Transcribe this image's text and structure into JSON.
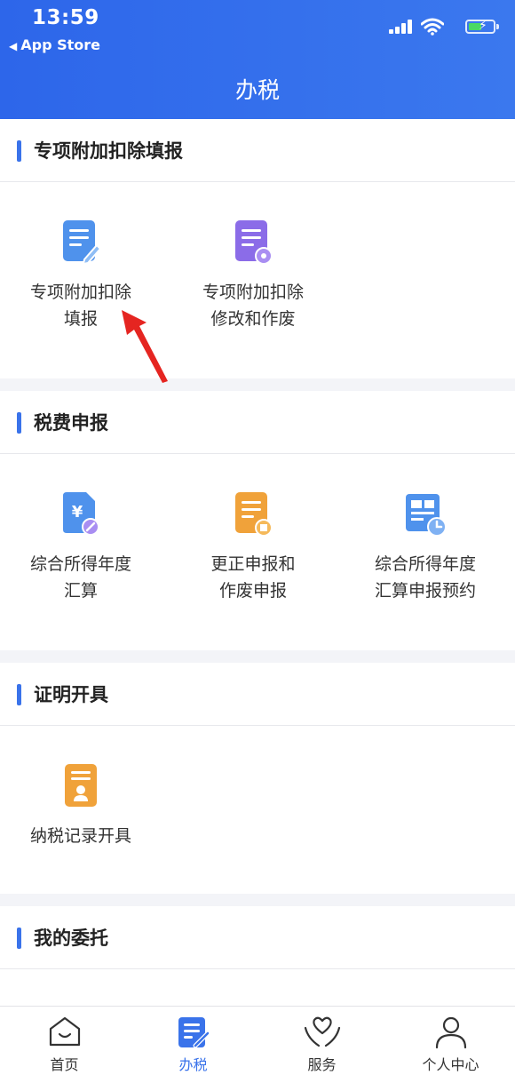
{
  "status_bar": {
    "time": "13:59",
    "back_label": "App Store"
  },
  "page": {
    "title": "办税"
  },
  "sections": [
    {
      "title": "专项附加扣除填报",
      "items": [
        {
          "label": "专项附加扣除\n填报",
          "icon": "doc-edit-icon"
        },
        {
          "label": "专项附加扣除\n修改和作废",
          "icon": "doc-gear-icon"
        }
      ]
    },
    {
      "title": "税费申报",
      "items": [
        {
          "label": "综合所得年度\n汇算",
          "icon": "yuan-doc-icon"
        },
        {
          "label": "更正申报和\n作废申报",
          "icon": "doc-stop-icon"
        },
        {
          "label": "综合所得年度\n汇算申报预约",
          "icon": "calendar-clock-icon"
        }
      ]
    },
    {
      "title": "证明开具",
      "items": [
        {
          "label": "纳税记录开具",
          "icon": "certificate-icon"
        }
      ]
    },
    {
      "title": "我的委托",
      "items": []
    }
  ],
  "tabbar": [
    {
      "label": "首页",
      "icon": "home-icon",
      "active": false
    },
    {
      "label": "办税",
      "icon": "tax-doc-icon",
      "active": true
    },
    {
      "label": "服务",
      "icon": "heart-hands-icon",
      "active": false
    },
    {
      "label": "个人中心",
      "icon": "person-icon",
      "active": false
    }
  ],
  "colors": {
    "header_blue": "#2d66ea",
    "accent_blue": "#3a73ea",
    "icon_blue": "#4f92ec",
    "icon_purple": "#8b6ce8",
    "icon_orange": "#f0a23a",
    "arrow_red": "#e52521"
  }
}
